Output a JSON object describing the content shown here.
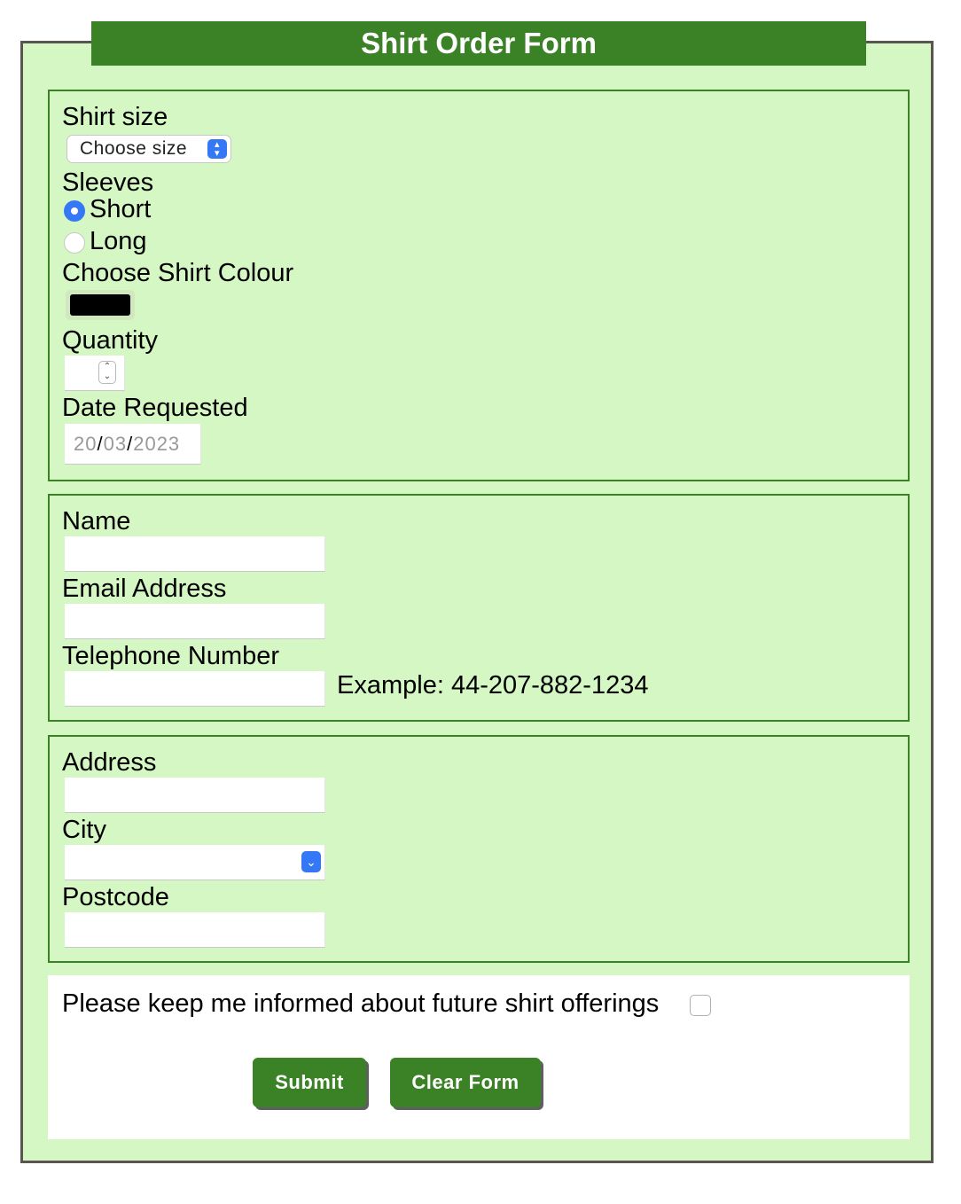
{
  "form": {
    "title": "Shirt Order Form"
  },
  "order": {
    "shirt_size_label": "Shirt size",
    "shirt_size_value": "Choose size",
    "sleeves_label": "Sleeves",
    "sleeve_options": [
      {
        "label": "Short",
        "selected": true
      },
      {
        "label": "Long",
        "selected": false
      }
    ],
    "colour_label": "Choose Shirt Colour",
    "colour_value": "#000000",
    "quantity_label": "Quantity",
    "quantity_value": "",
    "date_label": "Date Requested",
    "date_day": "20",
    "date_month": "03",
    "date_year": "2023",
    "date_sep": "/"
  },
  "contact": {
    "name_label": "Name",
    "name_value": "",
    "email_label": "Email Address",
    "email_value": "",
    "phone_label": "Telephone Number",
    "phone_value": "",
    "phone_example": "Example: 44-207-882-1234"
  },
  "address": {
    "address_label": "Address",
    "address_value": "",
    "city_label": "City",
    "city_value": "",
    "postcode_label": "Postcode",
    "postcode_value": ""
  },
  "footer": {
    "inform_label": "Please keep me informed about future shirt offerings",
    "inform_checked": false,
    "submit_label": "Submit",
    "clear_label": "Clear Form"
  },
  "colors": {
    "accent": "#3b8227",
    "panel_bg": "#d4f7c3",
    "border": "#5a5550",
    "select_button": "#3478f6"
  }
}
